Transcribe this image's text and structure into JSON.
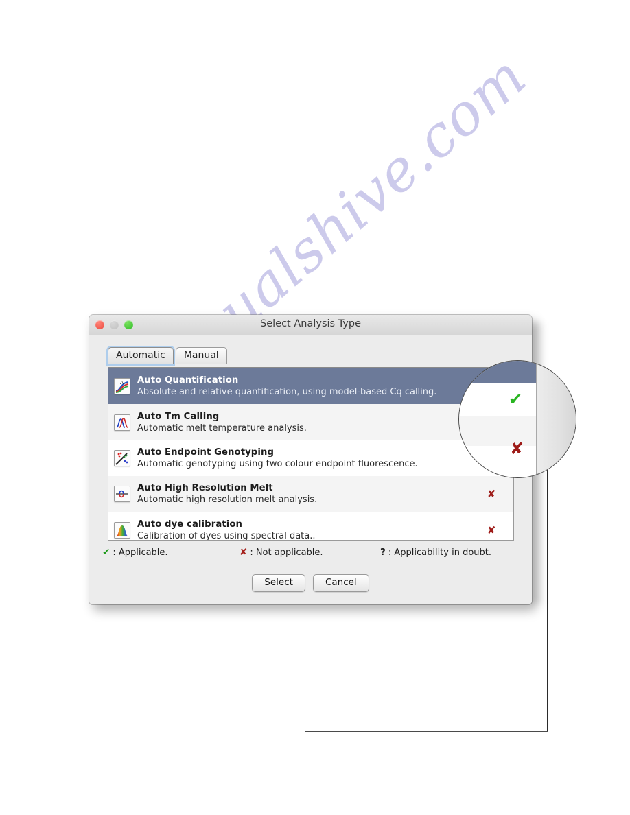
{
  "page": {
    "watermark": "manualshive.com"
  },
  "window": {
    "title": "Select Analysis Type",
    "traffic_lights": [
      "close-button",
      "minimize-button",
      "zoom-button"
    ]
  },
  "tabs": [
    {
      "label": "Automatic",
      "selected": true
    },
    {
      "label": "Manual",
      "selected": false
    }
  ],
  "list": {
    "items": [
      {
        "title": "Auto Quantification",
        "description": "Absolute and relative quantification, using model-based Cq calling.",
        "icon": "amplification-curve-icon",
        "mark": "✔",
        "mark_state": "applicable",
        "selected": true
      },
      {
        "title": "Auto Tm Calling",
        "description": "Automatic melt temperature analysis.",
        "icon": "melt-peaks-icon",
        "mark": "",
        "mark_state": "none",
        "selected": false
      },
      {
        "title": "Auto Endpoint Genotyping",
        "description": "Automatic genotyping using two colour endpoint fluorescence.",
        "icon": "genotyping-scatter-icon",
        "mark": "✘",
        "mark_state": "not-applicable",
        "selected": false
      },
      {
        "title": "Auto High Resolution Melt",
        "description": "Automatic high resolution melt analysis.",
        "icon": "hrm-curve-icon",
        "mark": "✘",
        "mark_state": "not-applicable",
        "selected": false
      },
      {
        "title": "Auto dye calibration",
        "description": "Calibration of dyes using spectral data..",
        "icon": "dye-spectrum-icon",
        "mark": "✘",
        "mark_state": "not-applicable",
        "selected": false
      }
    ]
  },
  "legend": [
    {
      "symbol": "✔",
      "text": ": Applicable.",
      "state": "applicable"
    },
    {
      "symbol": "✘",
      "text": ": Not applicable.",
      "state": "not-applicable"
    },
    {
      "symbol": "?",
      "text": ": Applicability in doubt.",
      "state": "doubt"
    }
  ],
  "buttons": {
    "select": "Select",
    "cancel": "Cancel"
  },
  "magnifier": {
    "applicable_mark": "✔",
    "not_applicable_mark": "✘"
  },
  "colors": {
    "selection": "#6c7a99",
    "applicable": "#22a81f",
    "not_applicable": "#9e1b18",
    "watermark": "#b9b7e4"
  }
}
